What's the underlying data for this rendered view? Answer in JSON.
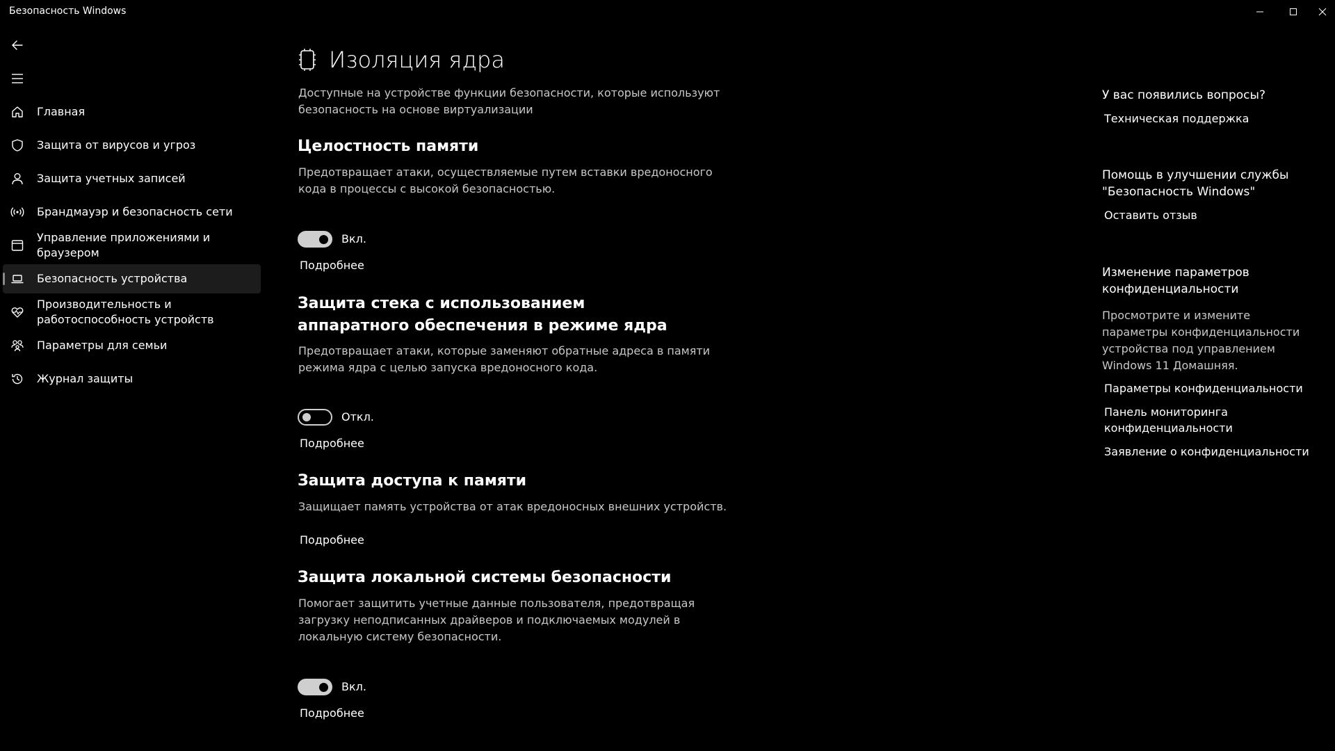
{
  "window": {
    "title": "Безопасность Windows"
  },
  "nav": {
    "items": [
      {
        "label": "Главная",
        "icon": "home-icon"
      },
      {
        "label": "Защита от вирусов и угроз",
        "icon": "shield-icon"
      },
      {
        "label": "Защита учетных записей",
        "icon": "person-icon"
      },
      {
        "label": "Брандмауэр и безопасность сети",
        "icon": "wifi-antenna-icon"
      },
      {
        "label": "Управление приложениями и браузером",
        "icon": "app-browser-icon"
      },
      {
        "label": "Безопасность устройства",
        "icon": "laptop-icon",
        "active": true
      },
      {
        "label": "Производительность и работоспособность устройств",
        "icon": "heart-pulse-icon"
      },
      {
        "label": "Параметры для семьи",
        "icon": "family-icon"
      },
      {
        "label": "Журнал защиты",
        "icon": "history-icon"
      }
    ]
  },
  "main": {
    "title": "Изоляция ядра",
    "intro": "Доступные на устройстве функции безопасности, которые используют безопасность на основе виртуализации",
    "sections": [
      {
        "title": "Целостность памяти",
        "description": "Предотвращает атаки, осуществляемые путем вставки вредоносного кода в процессы с высокой безопасностью.",
        "toggle_state": "on",
        "toggle_label": "Вкл.",
        "more_link": "Подробнее"
      },
      {
        "title": "Защита стека с использованием аппаратного обеспечения в режиме ядра",
        "description": "Предотвращает атаки, которые заменяют обратные адреса в памяти режима ядра с целью запуска вредоносного кода.",
        "toggle_state": "off",
        "toggle_label": "Откл.",
        "more_link": "Подробнее"
      },
      {
        "title": "Защита доступа к памяти",
        "description": "Защищает память устройства от атак вредоносных внешних устройств.",
        "more_link": "Подробнее"
      },
      {
        "title": "Защита локальной системы безопасности",
        "description": "Помогает защитить учетные данные пользователя, предотвращая загрузку неподписанных драйверов и подключаемых модулей в локальную систему безопасности.",
        "toggle_state": "on",
        "toggle_label": "Вкл.",
        "more_link": "Подробнее"
      }
    ]
  },
  "right_panel": {
    "questions_heading": "У вас появились вопросы?",
    "support_link": "Техническая поддержка",
    "improve_heading": "Помощь в улучшении службы \"Безопасность Windows\"",
    "feedback_link": "Оставить отзыв",
    "privacy_heading": "Изменение параметров конфиденциальности",
    "privacy_text": "Просмотрите и измените параметры конфиденциальности устройства под управлением Windows 11 Домашняя.",
    "privacy_links": [
      "Параметры конфиденциальности",
      "Панель мониторинга конфиденциальности",
      "Заявление о конфиденциальности"
    ]
  }
}
